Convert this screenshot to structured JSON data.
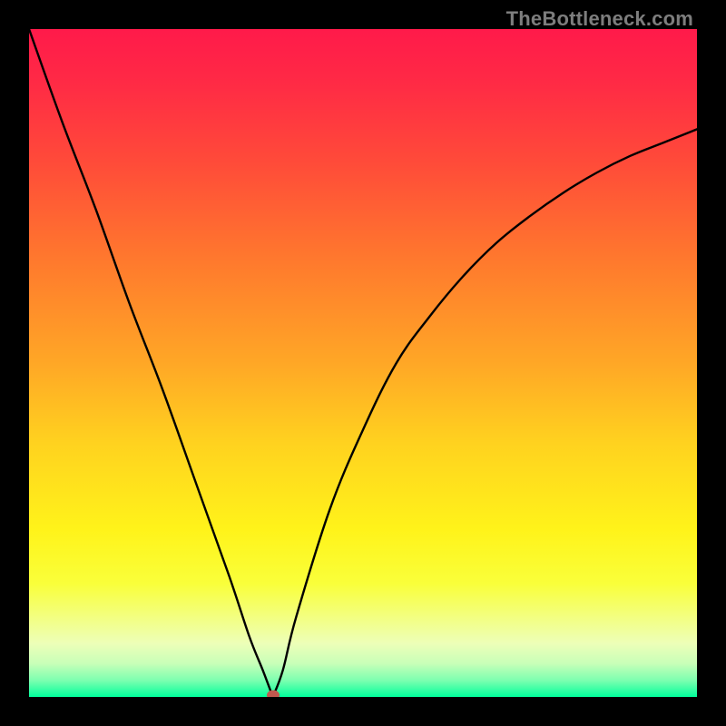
{
  "watermark": "TheBottleneck.com",
  "chart_data": {
    "type": "line",
    "title": "",
    "xlabel": "",
    "ylabel": "",
    "xlim": [
      0,
      100
    ],
    "ylim": [
      0,
      100
    ],
    "grid": false,
    "legend": false,
    "series": [
      {
        "name": "bottleneck-curve",
        "x": [
          0,
          5,
          10,
          15,
          20,
          25,
          30,
          33,
          35,
          36.5,
          38,
          40,
          45,
          50,
          55,
          60,
          65,
          70,
          75,
          80,
          85,
          90,
          95,
          100
        ],
        "y": [
          100,
          86,
          73,
          59,
          46,
          32,
          18,
          9,
          4,
          0,
          4,
          12,
          28,
          40,
          50,
          57,
          63,
          68,
          72,
          75.5,
          78.5,
          81,
          83,
          85
        ]
      }
    ],
    "marker": {
      "x": 36.5,
      "y": 0,
      "color": "#c1594f"
    },
    "gradient_stops": [
      {
        "offset": 0.0,
        "color": "#ff1a4a"
      },
      {
        "offset": 0.08,
        "color": "#ff2a45"
      },
      {
        "offset": 0.2,
        "color": "#ff4b39"
      },
      {
        "offset": 0.35,
        "color": "#ff7a2d"
      },
      {
        "offset": 0.5,
        "color": "#ffa726"
      },
      {
        "offset": 0.62,
        "color": "#ffd21f"
      },
      {
        "offset": 0.75,
        "color": "#fff31a"
      },
      {
        "offset": 0.83,
        "color": "#f9ff3a"
      },
      {
        "offset": 0.88,
        "color": "#f3ff80"
      },
      {
        "offset": 0.92,
        "color": "#edffb8"
      },
      {
        "offset": 0.95,
        "color": "#c8ffb8"
      },
      {
        "offset": 0.975,
        "color": "#7dffb0"
      },
      {
        "offset": 1.0,
        "color": "#00ff9c"
      }
    ]
  }
}
